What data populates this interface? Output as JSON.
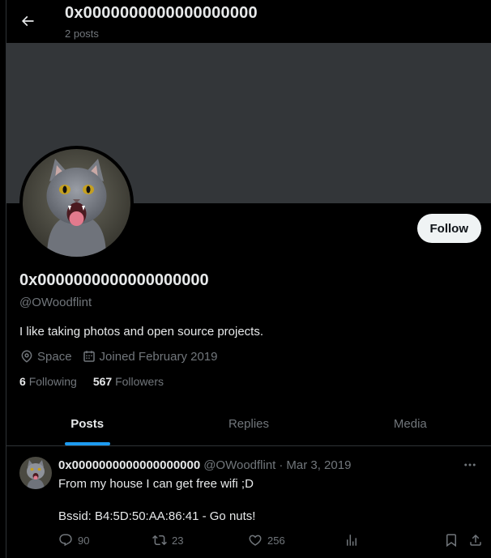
{
  "header": {
    "title": "0x0000000000000000000",
    "post_count": "2 posts"
  },
  "profile": {
    "display_name": "0x0000000000000000000",
    "handle": "@OWoodflint",
    "bio": "I like taking photos and open source projects.",
    "location": "Space",
    "joined": "Joined February 2019",
    "following_count": "6",
    "following_label": "Following",
    "followers_count": "567",
    "followers_label": "Followers",
    "follow_button": "Follow"
  },
  "tabs": [
    {
      "label": "Posts",
      "active": true
    },
    {
      "label": "Replies",
      "active": false
    },
    {
      "label": "Media",
      "active": false
    }
  ],
  "post": {
    "name": "0x0000000000000000000",
    "handle": "@OWoodflint",
    "separator": "·",
    "date": "Mar 3, 2019",
    "text_line1": "From my house I can get free wifi ;D",
    "text_line2": "Bssid: B4:5D:50:AA:86:41 - Go nuts!",
    "replies": "90",
    "reposts": "23",
    "likes": "256"
  },
  "colors": {
    "background": "#000000",
    "banner": "#333639",
    "accent": "#1d9bf0",
    "muted_text": "#71767b",
    "primary_text": "#e7e9ea",
    "follow_button_bg": "#eff3f4"
  },
  "icons": [
    "back-arrow-icon",
    "location-pin-icon",
    "calendar-icon",
    "more-icon",
    "reply-icon",
    "repost-icon",
    "like-icon",
    "views-icon",
    "bookmark-icon",
    "share-icon"
  ]
}
